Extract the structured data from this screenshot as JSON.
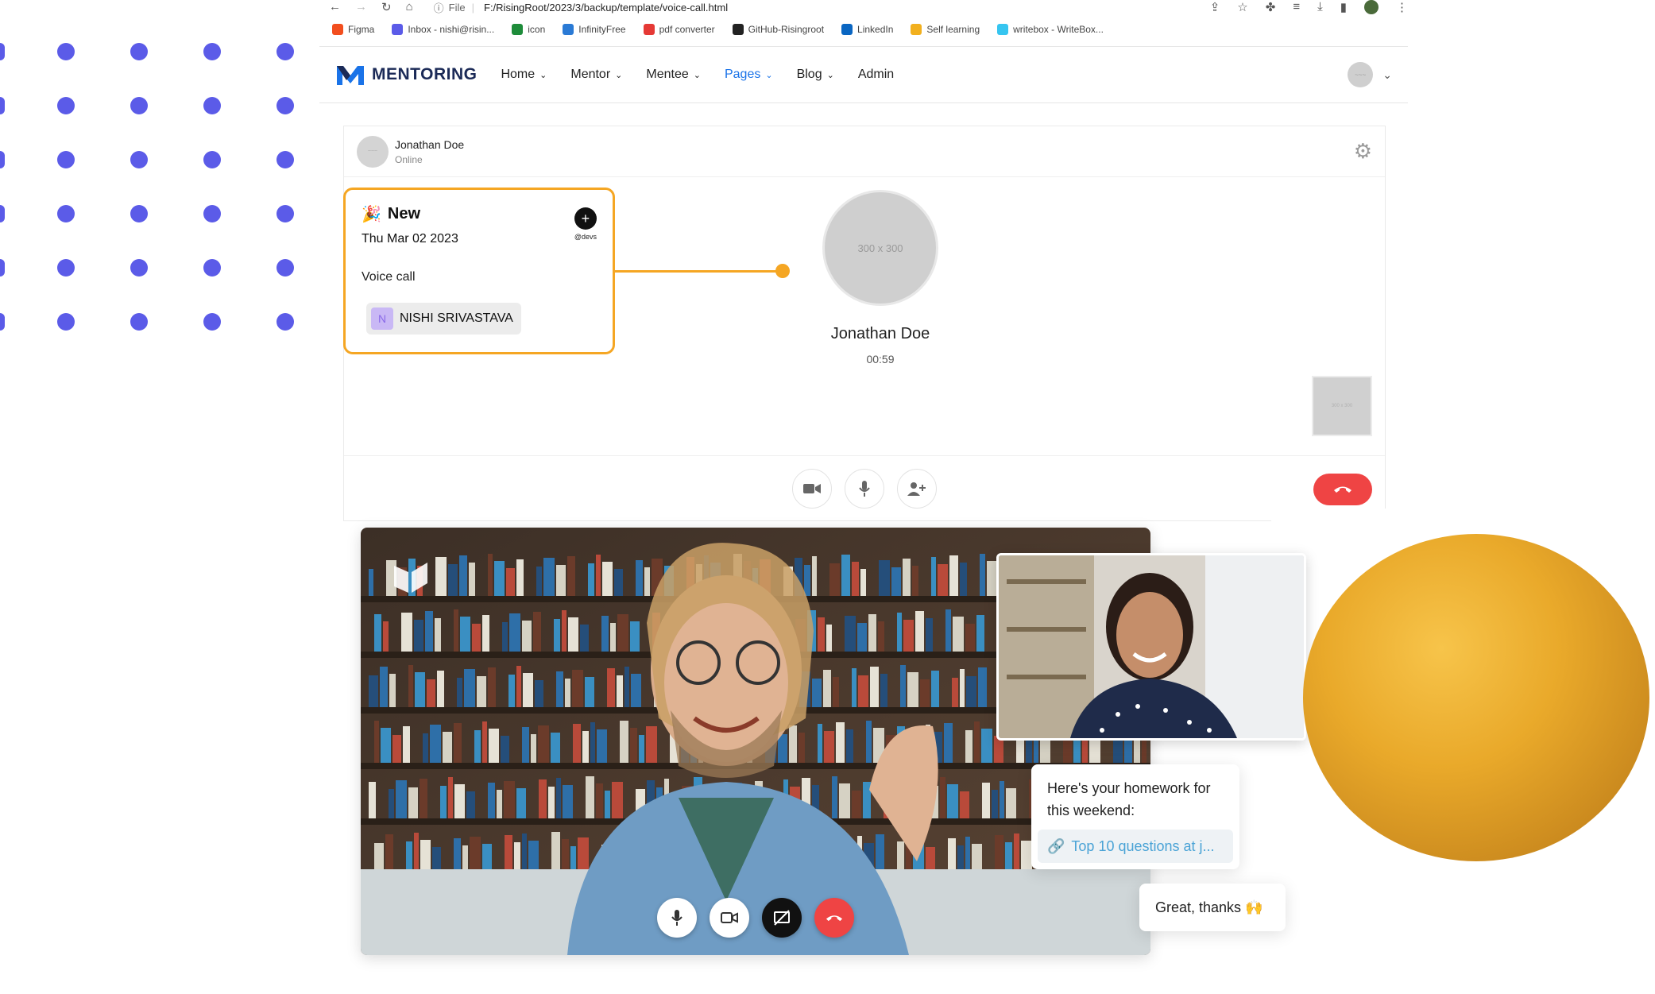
{
  "browser": {
    "protocol_label": "File",
    "url": "F:/RisingRoot/2023/3/backup/template/voice-call.html",
    "bookmarks": [
      {
        "label": "Figma",
        "icon": "figma-icon",
        "color": "#f24e1e"
      },
      {
        "label": "Inbox - nishi@risin...",
        "icon": "mail-icon",
        "color": "#5b5be8"
      },
      {
        "label": "icon",
        "icon": "w-icon",
        "color": "#1e8c3a"
      },
      {
        "label": "InfinityFree",
        "icon": "infinity-icon",
        "color": "#2a7ad5"
      },
      {
        "label": "pdf converter",
        "icon": "heart-icon",
        "color": "#e53935"
      },
      {
        "label": "GitHub-Risingroot",
        "icon": "github-icon",
        "color": "#222222"
      },
      {
        "label": "LinkedIn",
        "icon": "linkedin-icon",
        "color": "#0a66c2"
      },
      {
        "label": "Self learning",
        "icon": "bars-icon",
        "color": "#f2b01e"
      },
      {
        "label": "writebox - WriteBox...",
        "icon": "slack-icon",
        "color": "#36c5f0"
      }
    ]
  },
  "navbar": {
    "brand": "MENTORING",
    "menu": [
      {
        "label": "Home",
        "chevron": "⌄",
        "active": false
      },
      {
        "label": "Mentor",
        "chevron": "⌄",
        "active": false
      },
      {
        "label": "Mentee",
        "chevron": "⌄",
        "active": false
      },
      {
        "label": "Pages",
        "chevron": "⌄",
        "active": true
      },
      {
        "label": "Blog",
        "chevron": "⌄",
        "active": false
      },
      {
        "label": "Admin",
        "chevron": "",
        "active": false
      }
    ]
  },
  "call": {
    "header_name": "Jonathan Doe",
    "header_status": "Online",
    "callee_placeholder": "300 x 300",
    "callee_name": "Jonathan Doe",
    "timer": "00:59",
    "self_placeholder": "300 x 300"
  },
  "event": {
    "emoji": "🎉",
    "title": "New",
    "date": "Thu Mar 02 2023",
    "description": "Voice call",
    "person_initial": "N",
    "person_name": "NISHI SRIVASTAVA",
    "add_handle": "@devs"
  },
  "chat": {
    "message1": "Here's your homework for this weekend:",
    "link": "Top 10 questions at j...",
    "message2": "Great, thanks 🙌"
  },
  "colors": {
    "accent": "#f5a623",
    "brand": "#1b2a57",
    "active_link": "#1a73e8",
    "hangup": "#ef4444",
    "dots": "#5b5be8"
  }
}
